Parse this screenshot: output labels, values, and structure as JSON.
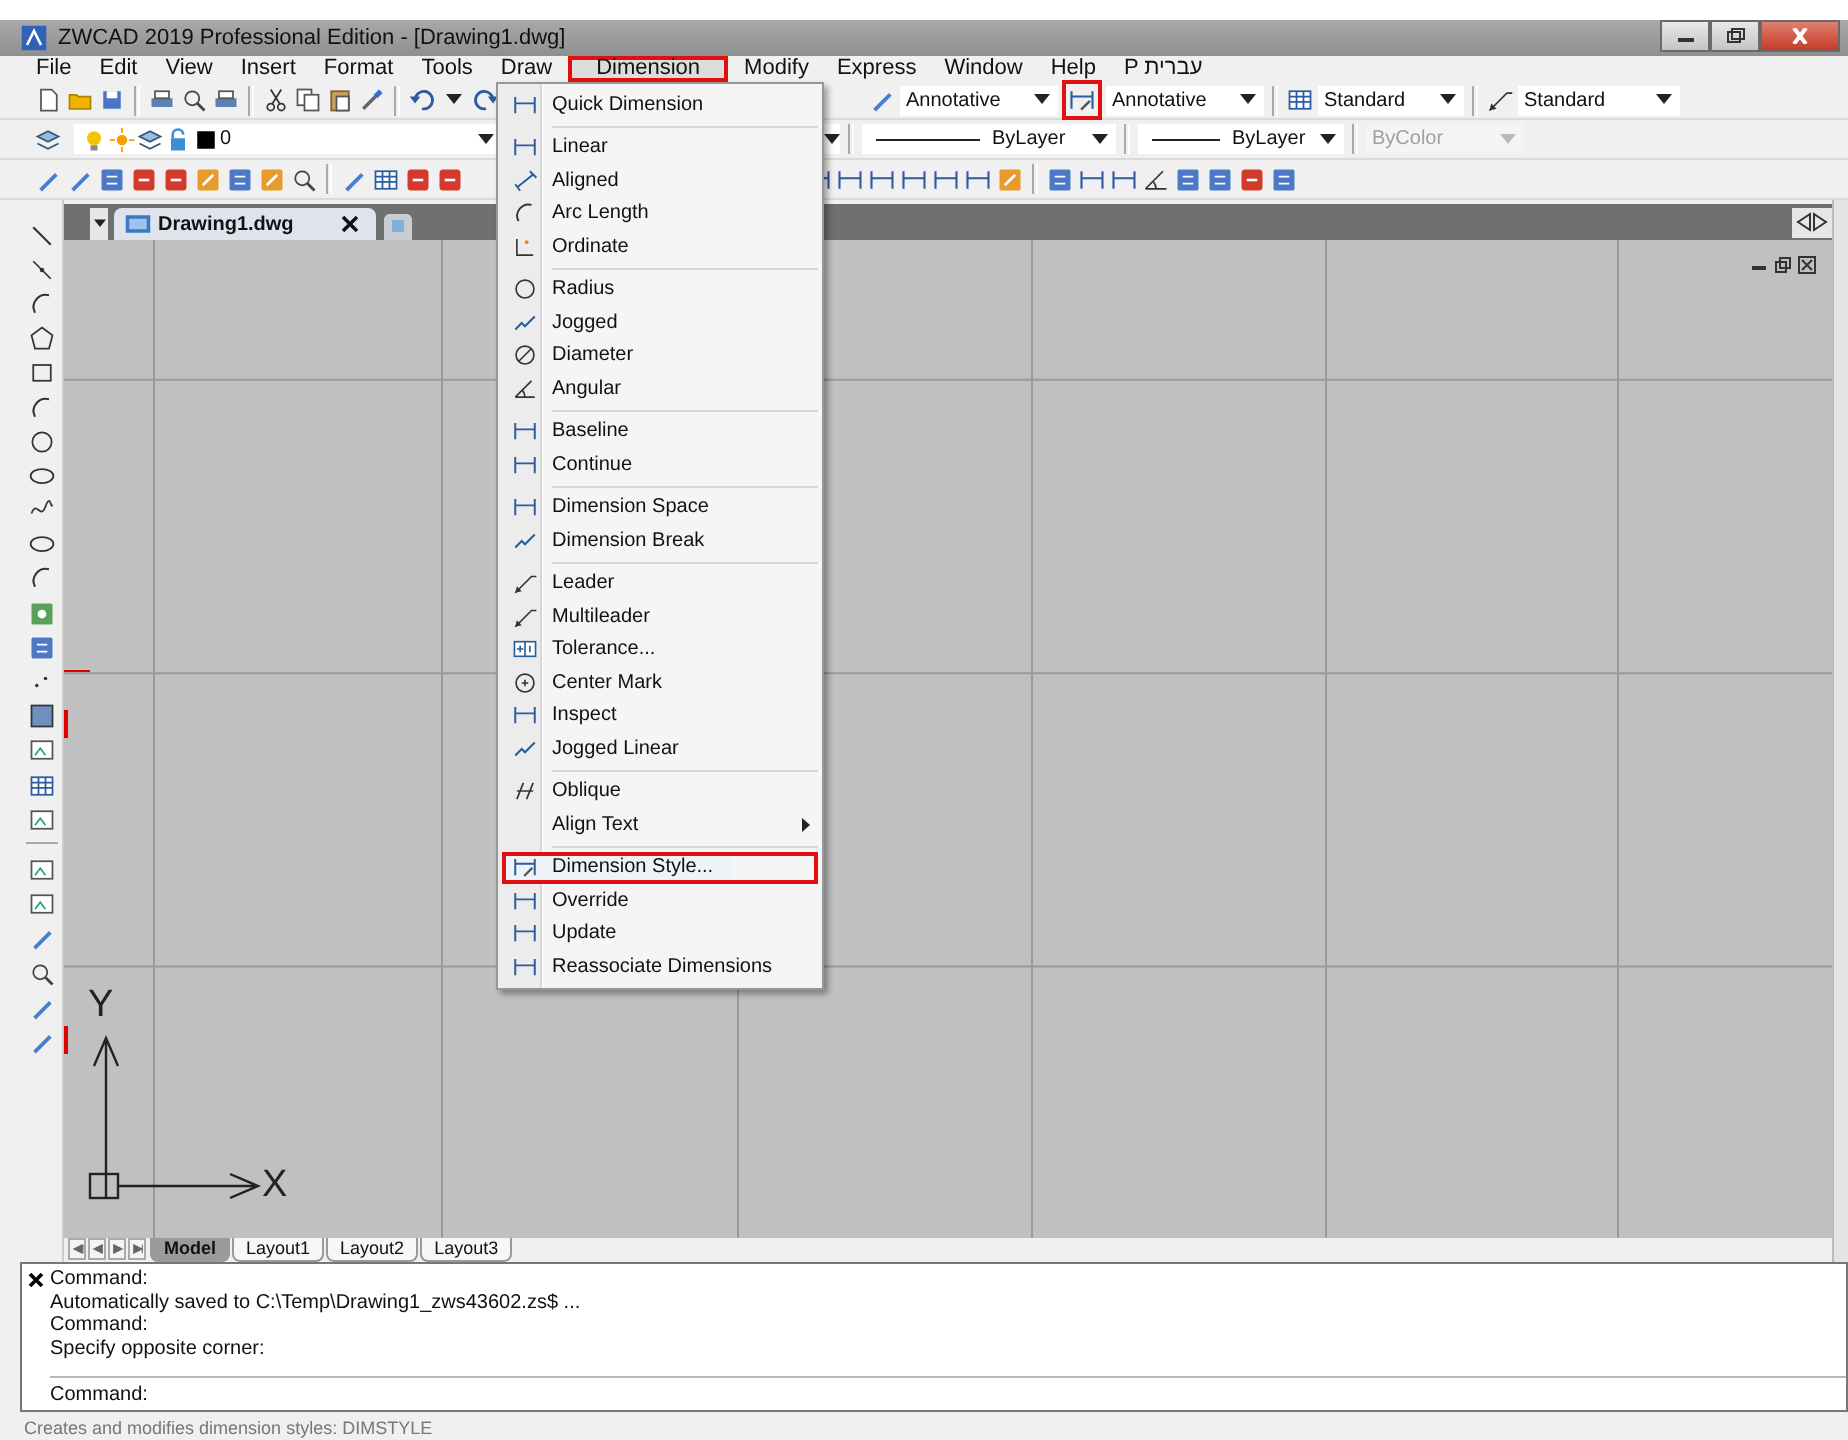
{
  "window": {
    "title": "ZWCAD 2019 Professional Edition - [Drawing1.dwg]"
  },
  "menu_bar": [
    {
      "label": "File",
      "selected": false,
      "highlighted": false
    },
    {
      "label": "Edit",
      "selected": false,
      "highlighted": false
    },
    {
      "label": "View",
      "selected": false,
      "highlighted": false
    },
    {
      "label": "Insert",
      "selected": false,
      "highlighted": false
    },
    {
      "label": "Format",
      "selected": false,
      "highlighted": false
    },
    {
      "label": "Tools",
      "selected": false,
      "highlighted": false
    },
    {
      "label": "Draw",
      "selected": false,
      "highlighted": false
    },
    {
      "label": "Dimension",
      "selected": true,
      "highlighted": true
    },
    {
      "label": "Modify",
      "selected": false,
      "highlighted": false
    },
    {
      "label": "Express",
      "selected": false,
      "highlighted": false
    },
    {
      "label": "Window",
      "selected": false,
      "highlighted": false
    },
    {
      "label": "Help",
      "selected": false,
      "highlighted": false
    },
    {
      "label": "P עברית",
      "selected": false,
      "highlighted": false
    }
  ],
  "style_toolbar": [
    {
      "value": "Annotative",
      "highlighted": false
    },
    {
      "value": "Annotative",
      "highlighted": true
    },
    {
      "value": "Standard",
      "highlighted": false
    },
    {
      "value": "Standard",
      "highlighted": false
    }
  ],
  "properties_toolbar": {
    "layer": "0",
    "linetype": "ByLayer",
    "lineweight": "ByLayer",
    "plot_style": {
      "value": "ByColor",
      "disabled": true
    }
  },
  "document_tabs": [
    {
      "label": "Drawing1.dwg",
      "selected": true
    }
  ],
  "dimension_menu": {
    "groups": [
      [
        {
          "label": "Quick Dimension",
          "selected": false,
          "highlighted": false,
          "submenu": false
        }
      ],
      [
        {
          "label": "Linear",
          "selected": false,
          "highlighted": false,
          "submenu": false
        },
        {
          "label": "Aligned",
          "selected": false,
          "highlighted": false,
          "submenu": false
        },
        {
          "label": "Arc Length",
          "selected": false,
          "highlighted": false,
          "submenu": false
        },
        {
          "label": "Ordinate",
          "selected": false,
          "highlighted": false,
          "submenu": false
        }
      ],
      [
        {
          "label": "Radius",
          "selected": false,
          "highlighted": false,
          "submenu": false
        },
        {
          "label": "Jogged",
          "selected": false,
          "highlighted": false,
          "submenu": false
        },
        {
          "label": "Diameter",
          "selected": false,
          "highlighted": false,
          "submenu": false
        },
        {
          "label": "Angular",
          "selected": false,
          "highlighted": false,
          "submenu": false
        }
      ],
      [
        {
          "label": "Baseline",
          "selected": false,
          "highlighted": false,
          "submenu": false
        },
        {
          "label": "Continue",
          "selected": false,
          "highlighted": false,
          "submenu": false
        }
      ],
      [
        {
          "label": "Dimension Space",
          "selected": false,
          "highlighted": false,
          "submenu": false
        },
        {
          "label": "Dimension Break",
          "selected": false,
          "highlighted": false,
          "submenu": false
        }
      ],
      [
        {
          "label": "Leader",
          "selected": false,
          "highlighted": false,
          "submenu": false
        },
        {
          "label": "Multileader",
          "selected": false,
          "highlighted": false,
          "submenu": false
        },
        {
          "label": "Tolerance...",
          "selected": false,
          "highlighted": false,
          "submenu": false
        },
        {
          "label": "Center Mark",
          "selected": false,
          "highlighted": false,
          "submenu": false
        },
        {
          "label": "Inspect",
          "selected": false,
          "highlighted": false,
          "submenu": false
        },
        {
          "label": "Jogged Linear",
          "selected": false,
          "highlighted": false,
          "submenu": false
        }
      ],
      [
        {
          "label": "Oblique",
          "selected": false,
          "highlighted": false,
          "submenu": false
        },
        {
          "label": "Align Text",
          "selected": false,
          "highlighted": false,
          "submenu": true
        }
      ],
      [
        {
          "label": "Dimension Style...",
          "selected": true,
          "highlighted": true,
          "submenu": false
        },
        {
          "label": "Override",
          "selected": false,
          "highlighted": false,
          "submenu": false
        },
        {
          "label": "Update",
          "selected": false,
          "highlighted": false,
          "submenu": false
        },
        {
          "label": "Reassociate Dimensions",
          "selected": false,
          "highlighted": false,
          "submenu": false
        }
      ]
    ]
  },
  "ucs": {
    "x_label": "X",
    "y_label": "Y"
  },
  "layout_tabs": [
    {
      "label": "Model",
      "selected": true
    },
    {
      "label": "Layout1",
      "selected": false
    },
    {
      "label": "Layout2",
      "selected": false
    },
    {
      "label": "Layout3",
      "selected": false
    }
  ],
  "command_window": {
    "history": [
      "Command:",
      "Automatically saved to C:\\Temp\\Drawing1_zws43602.zs$ ...",
      "Command:",
      "Specify opposite corner:"
    ],
    "prompt": "Command:"
  },
  "status_bar": {
    "text": "Creates and modifies dimension styles: DIMSTYLE"
  }
}
